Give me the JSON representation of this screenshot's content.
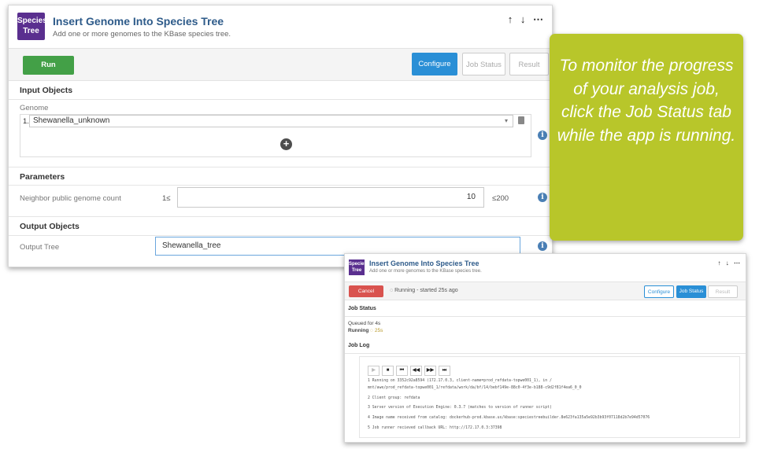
{
  "app": {
    "logo_line1": "Species",
    "logo_line2": "Tree",
    "title": "Insert Genome Into Species Tree",
    "subtitle": "Add one or more genomes to the KBase species tree.",
    "arrows": "↑ ↓ ⋯",
    "run_label": "Run",
    "tabs": {
      "configure": "Configure",
      "job_status": "Job Status",
      "result": "Result"
    },
    "input_objects": {
      "section": "Input Objects",
      "genome_label": "Genome",
      "genome_index": "1.",
      "genome_value": "Shewanella_unknown",
      "add_symbol": "+"
    },
    "parameters": {
      "section": "Parameters",
      "neighbor_label": "Neighbor public genome count",
      "min_text": "1≤",
      "value": "10",
      "max_text": "≤200"
    },
    "output_objects": {
      "section": "Output Objects",
      "output_label": "Output Tree",
      "output_value": "Shewanella_tree"
    },
    "info_symbol": "i"
  },
  "callout": {
    "text": "To monitor the progress of your analysis job, click the Job Status tab while the app is running."
  },
  "app_running": {
    "logo_line1": "Species",
    "logo_line2": "Tree",
    "title": "Insert Genome Into Species Tree",
    "subtitle": "Add one or more genomes to the KBase species tree.",
    "arrows": "↑ ↓ ⋯",
    "cancel_label": "Cancel",
    "running_status": "◌ Running - started 25s ago",
    "tabs": {
      "configure": "Configure",
      "job_status": "Job Status",
      "result": "Result"
    },
    "job_status_section": "Job Status",
    "queued_text": "Queued for 4s",
    "running_label": "Running",
    "running_time": "◌ 25s",
    "job_log_section": "Job Log",
    "log_controls": [
      "▶",
      "■",
      "⏮",
      "◀◀",
      "▶▶",
      "⏭"
    ],
    "log_lines": [
      "1 Running on 3352c92a8594 (172.17.0.3, client-name=prod_refdata-topwe001_1), in /",
      "  mnt/awe/prod_refdata-topwe001_1/refdata/work/da/bf/14/bebf149e-88c0-4f3e-b188-c9d2f81f4ea6_0_0",
      "2 Client group: refdata",
      "3 Server version of Execution Engine: 0.3.7 (matches to version of runner script)",
      "4 Image name received from catalog: dockerhub-prod.kbase.us/kbase:speciestreebuilder.8e623fa135a5e92b3b93f07118d2b7e94d57076",
      "5 Job runner recieved callback URL: http://172.17.0.3:37398"
    ]
  }
}
